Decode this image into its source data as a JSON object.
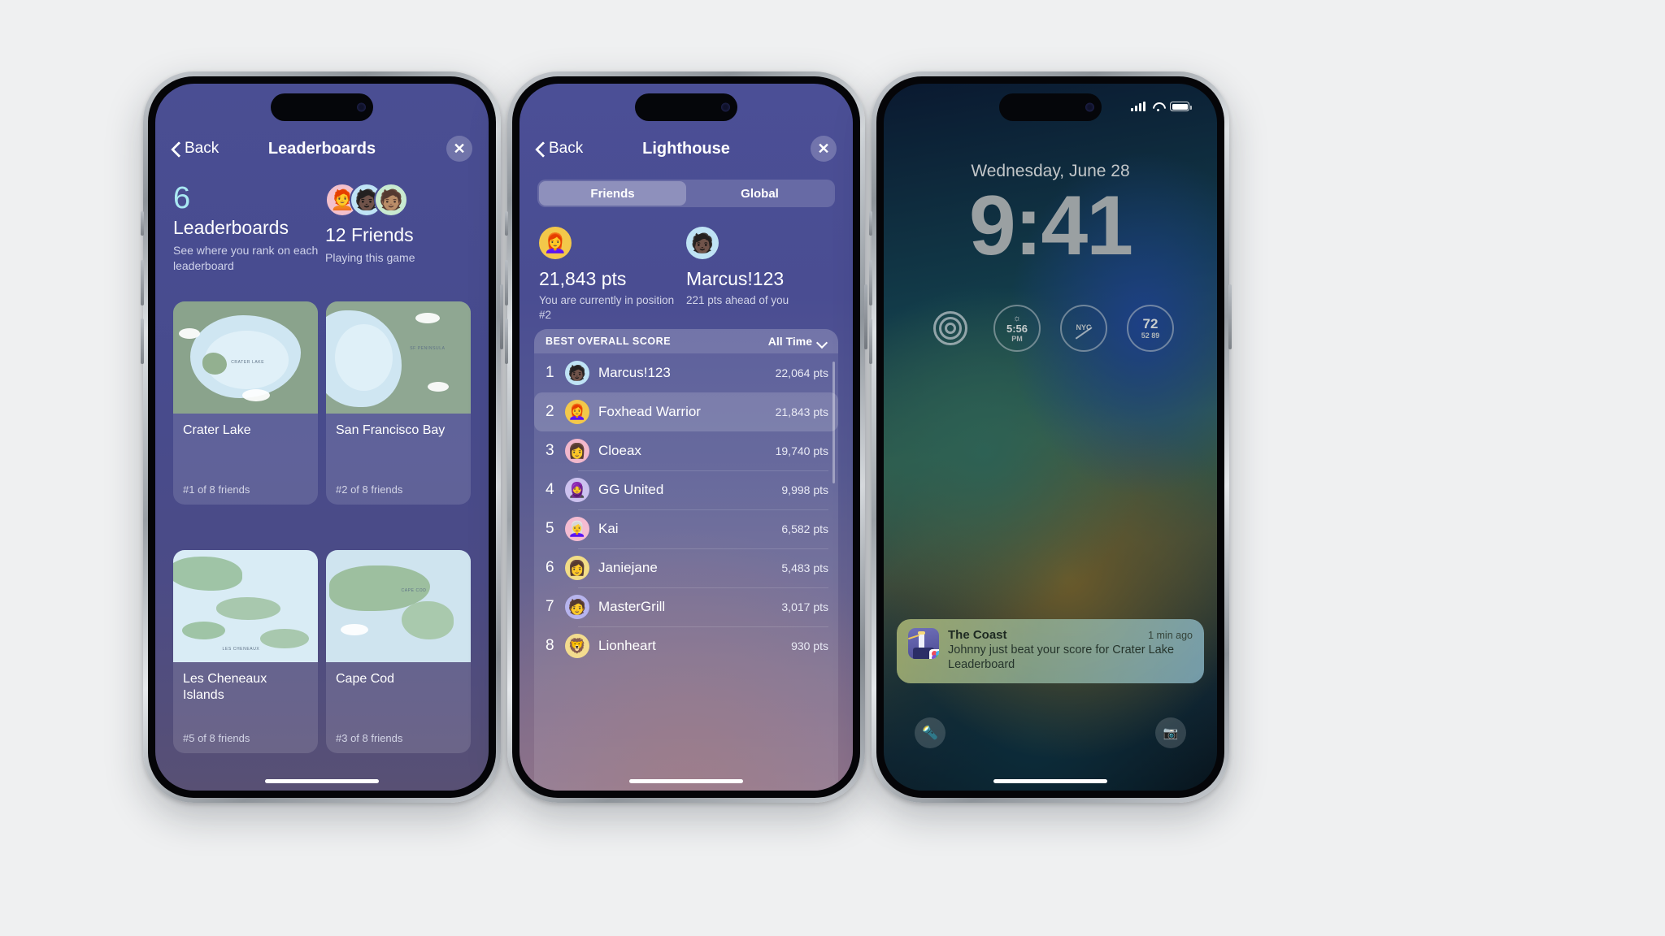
{
  "phone1": {
    "nav": {
      "back": "Back",
      "title": "Leaderboards",
      "close": "✕"
    },
    "summary": {
      "count": "6",
      "count_title": "Leaderboards",
      "count_sub": "See where you rank on each leaderboard",
      "friends_title": "12 Friends",
      "friends_sub": "Playing this game",
      "avatars": [
        "🧑‍🦰",
        "🧑🏿",
        "🧑🏽"
      ]
    },
    "cards": [
      {
        "name": "Crater Lake",
        "rank": "#1 of 8 friends",
        "map_label": "CRATER LAKE"
      },
      {
        "name": "San Francisco Bay",
        "rank": "#2 of 8 friends",
        "map_label": "SF PENINSULA"
      },
      {
        "name": "Les Cheneaux Islands",
        "rank": "#5 of 8 friends",
        "map_label": "LES CHENEAUX"
      },
      {
        "name": "Cape Cod",
        "rank": "#3 of 8 friends",
        "map_label": "CAPE COD"
      }
    ]
  },
  "phone2": {
    "nav": {
      "back": "Back",
      "title": "Lighthouse",
      "close": "✕"
    },
    "segments": [
      {
        "label": "Friends",
        "selected": true
      },
      {
        "label": "Global",
        "selected": false
      }
    ],
    "you": {
      "avatar": "👩‍🦰",
      "score": "21,843 pts",
      "sub": "You are currently in position #2"
    },
    "leader": {
      "avatar": "🧑🏿",
      "name": "Marcus!123",
      "sub": "221 pts ahead of you"
    },
    "board": {
      "header": "BEST OVERALL SCORE",
      "filter": "All Time",
      "rows": [
        {
          "rank": "1",
          "avatar": "🧑🏿",
          "name": "Marcus!123",
          "points": "22,064 pts",
          "highlighted": false,
          "color": "#bfe3f5"
        },
        {
          "rank": "2",
          "avatar": "👩‍🦰",
          "name": "Foxhead Warrior",
          "points": "21,843 pts",
          "highlighted": true,
          "color": "#f3c84a"
        },
        {
          "rank": "3",
          "avatar": "👩",
          "name": "Cloeax",
          "points": "19,740 pts",
          "highlighted": false,
          "color": "#f2b8cc"
        },
        {
          "rank": "4",
          "avatar": "🧕",
          "name": "GG United",
          "points": "9,998 pts",
          "highlighted": false,
          "color": "#ccc2ef"
        },
        {
          "rank": "5",
          "avatar": "👩‍🦳",
          "name": "Kai",
          "points": "6,582 pts",
          "highlighted": false,
          "color": "#f5bcd2"
        },
        {
          "rank": "6",
          "avatar": "👩",
          "name": "Janiejane",
          "points": "5,483 pts",
          "highlighted": false,
          "color": "#f2dd86"
        },
        {
          "rank": "7",
          "avatar": "🧑",
          "name": "MasterGrill",
          "points": "3,017 pts",
          "highlighted": false,
          "color": "#b7b4ee"
        },
        {
          "rank": "8",
          "avatar": "🦁",
          "name": "Lionheart",
          "points": "930 pts",
          "highlighted": false,
          "color": "#f3dc8e"
        }
      ]
    }
  },
  "phone3": {
    "date": "Wednesday, June 28",
    "time": "9:41",
    "widgets": [
      {
        "name": "fitness-rings-widget",
        "top": "",
        "bottom": ""
      },
      {
        "name": "sunset-widget",
        "top": "5:56",
        "bottom": "PM"
      },
      {
        "name": "world-clock-widget",
        "top": "NYC",
        "bottom": ""
      },
      {
        "name": "weather-widget",
        "top": "72",
        "bottom": "52  89"
      }
    ],
    "notification": {
      "app": "The Coast",
      "time": "1 min ago",
      "text": "Johnny just beat your score for Crater Lake Leaderboard"
    },
    "actions": {
      "left": "flashlight-icon",
      "right": "camera-icon"
    }
  }
}
